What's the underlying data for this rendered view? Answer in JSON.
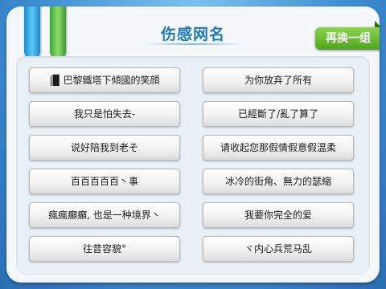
{
  "title": "伤感网名",
  "refresh_label": "再换一组",
  "names_left": [
    "|▉ 巴黎鐵塔下傾國的笑顔",
    "我只是怕失去-",
    "说好陪我到老そ",
    "百百百百百丶事",
    "瘋瘋癲癲, 也是一种境界丶",
    "往昔容貌°"
  ],
  "names_right": [
    "为你放弃了所有",
    "已經斷了/亂了算了",
    "请收起您那假情假意假温柔",
    "冰冷的街角、無力的瑟縮",
    "我要你完全的爱",
    "ヾ内心兵荒马乱"
  ],
  "colors": {
    "background": "#3a84c9",
    "title": "#1f7bb8",
    "refresh_button": "#5bb02a",
    "ribbon_blue": "#2aa0e0",
    "ribbon_green": "#5fbf45"
  }
}
